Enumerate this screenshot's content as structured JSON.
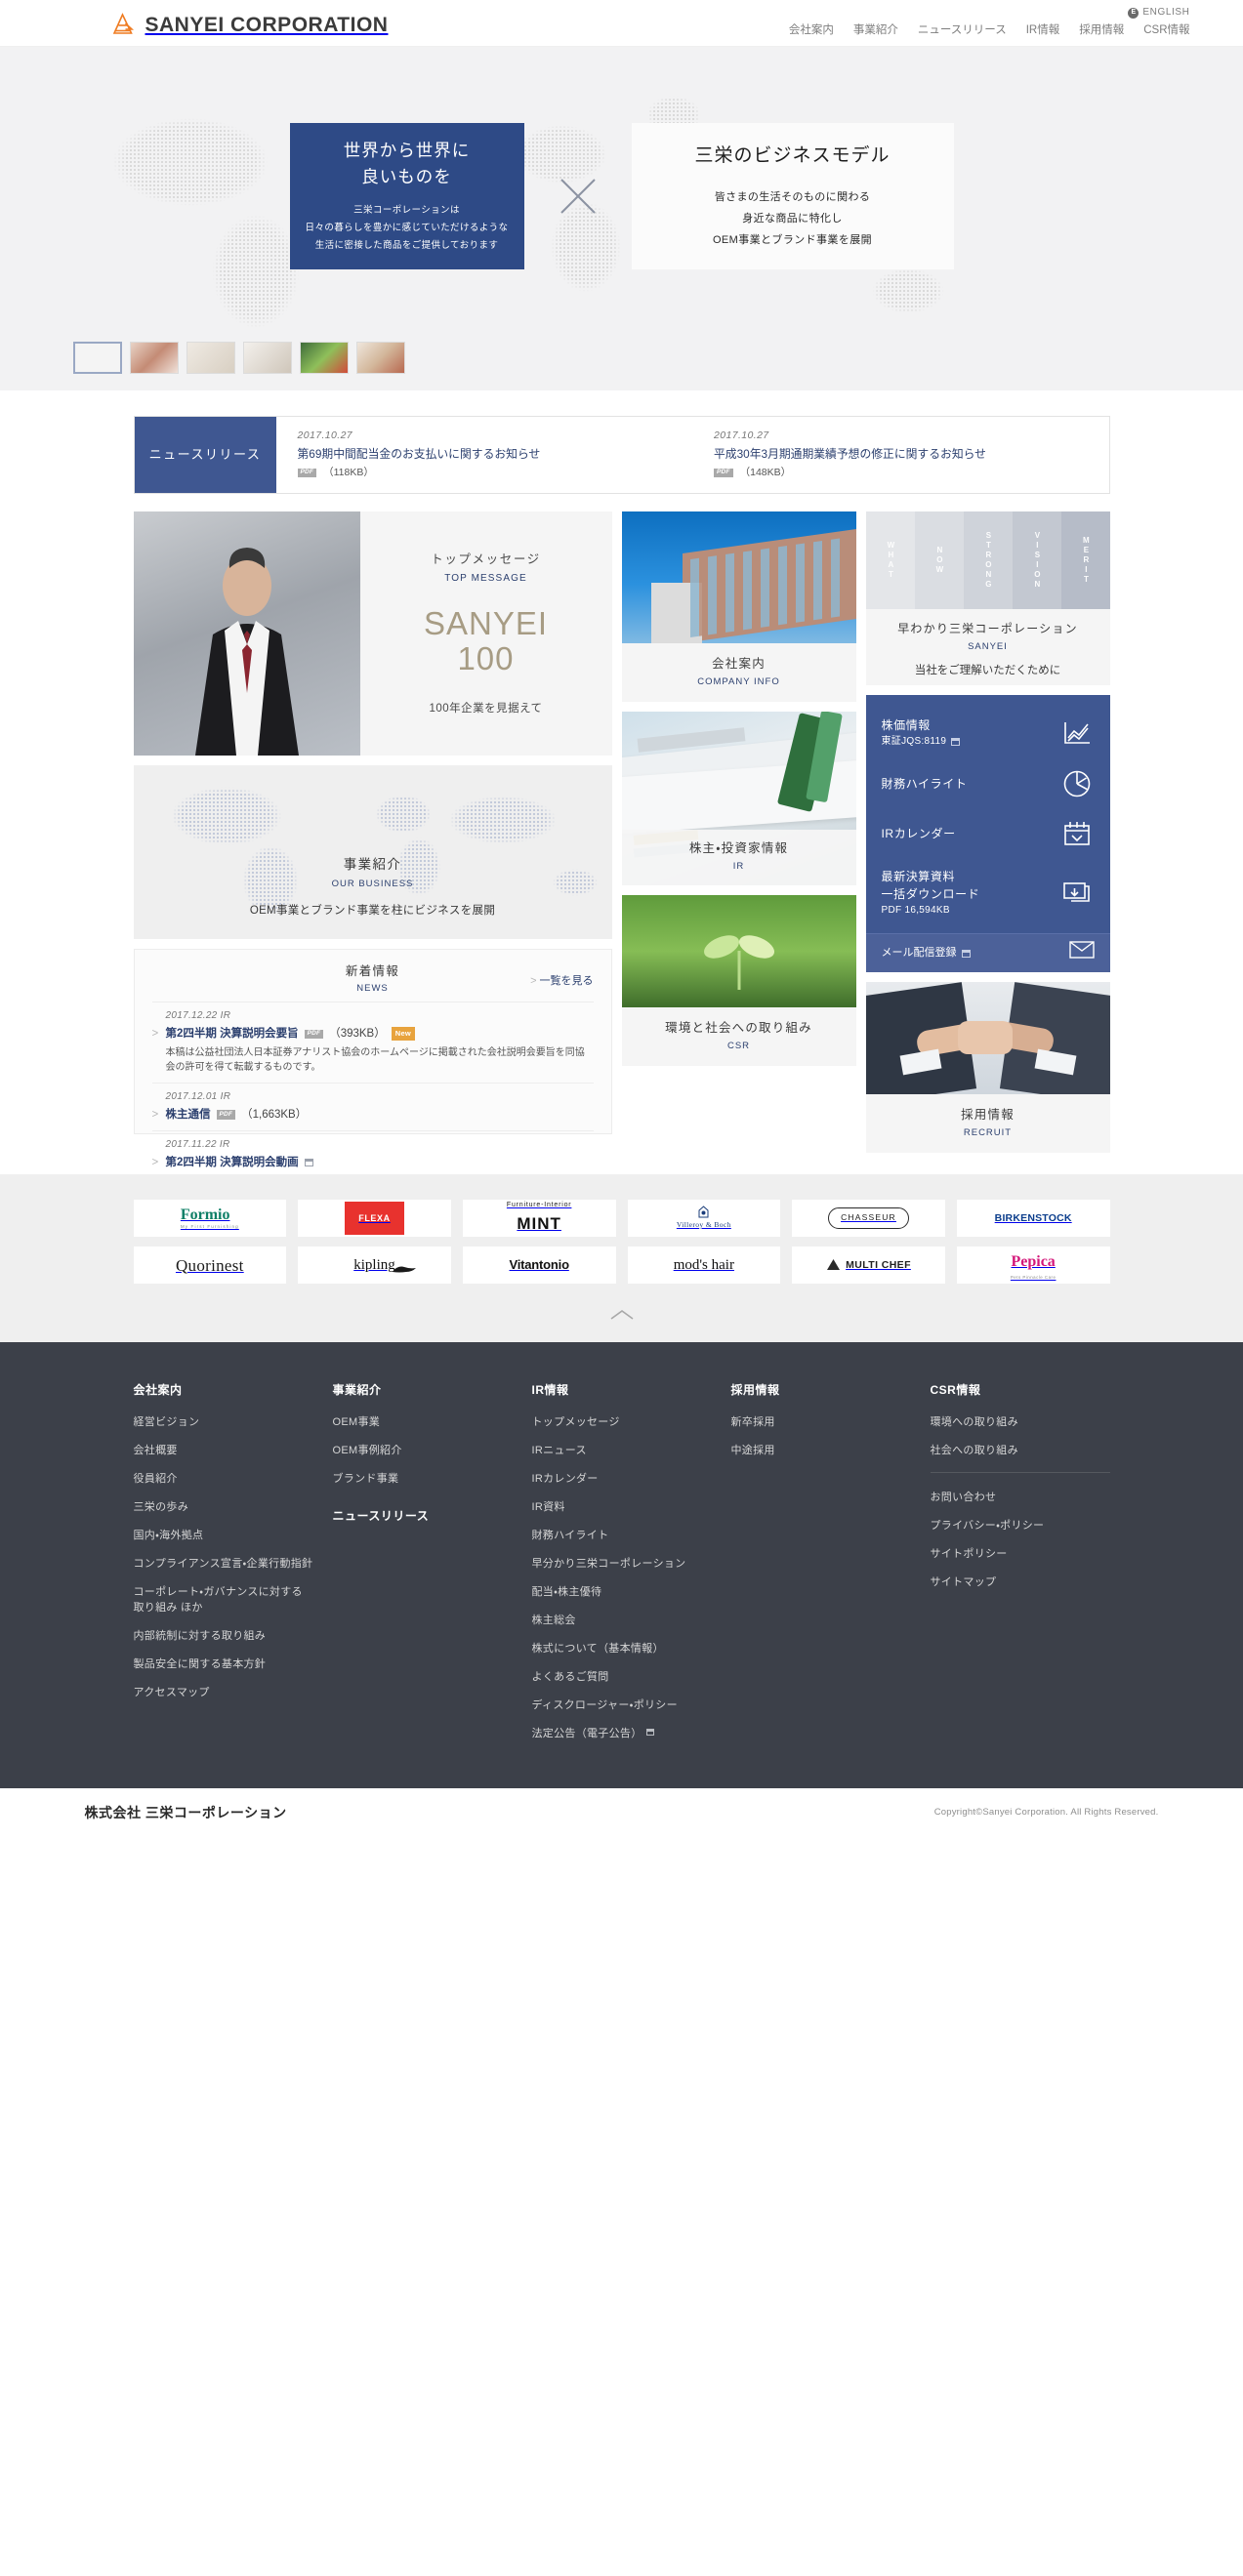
{
  "header": {
    "logo_text": "SANYEI CORPORATION",
    "lang_label": "ENGLISH",
    "lang_icon": "globe-icon",
    "nav": [
      {
        "label": "会社案内"
      },
      {
        "label": "事業紹介"
      },
      {
        "label": "ニュースリリース"
      },
      {
        "label": "IR情報"
      },
      {
        "label": "採用情報"
      },
      {
        "label": "CSR情報"
      }
    ]
  },
  "hero": {
    "left": {
      "heading_line1": "世界から世界に",
      "heading_line2": "良いものを",
      "body_line1": "三栄コーポレーションは",
      "body_line2": "日々の暮らしを豊かに感じていただけるような",
      "body_line3": "生活に密接した商品をご提供しております"
    },
    "divider_icon": "cross-icon",
    "right": {
      "heading": "三栄のビジネスモデル",
      "body_line1": "皆さまの生活そのものに関わる",
      "body_line2": "身近な商品に特化し",
      "body_line3": "OEM事業とブランド事業を展開"
    },
    "thumbnails": [
      {
        "name": "thumb-world-map",
        "selected": true
      },
      {
        "name": "thumb-cosmetics",
        "selected": false
      },
      {
        "name": "thumb-slippers",
        "selected": false
      },
      {
        "name": "thumb-interior",
        "selected": false
      },
      {
        "name": "thumb-toys",
        "selected": false
      },
      {
        "name": "thumb-tableware",
        "selected": false
      }
    ]
  },
  "news_release": {
    "label": "ニュースリリース",
    "items": [
      {
        "date": "2017.10.27",
        "title": "第69期中間配当金のお支払いに関するお知らせ",
        "badge": "PDF",
        "size": "（118KB）"
      },
      {
        "date": "2017.10.27",
        "title": "平成30年3月期通期業績予想の修正に関するお知らせ",
        "badge": "PDF",
        "size": "（148KB）"
      }
    ]
  },
  "cards": {
    "top_message": {
      "jp": "トップメッセージ",
      "en": "TOP MESSAGE",
      "big_line1": "SANYEI",
      "big_line2": "100",
      "sub": "100年企業を見据えて"
    },
    "company_info": {
      "jp": "会社案内",
      "en": "COMPANY INFO"
    },
    "hayawakari": {
      "jp": "早わかり三栄コーポレーション",
      "en": "SANYEI",
      "sub": "当社をご理解いただくために",
      "segments": [
        "WHAT",
        "NOW",
        "STRONG",
        "VISION",
        "MERIT"
      ]
    },
    "business": {
      "jp": "事業紹介",
      "en": "OUR BUSINESS",
      "sub": "OEM事業とブランド事業を柱にビジネスを展開"
    },
    "ir": {
      "jp": "株主・投資家情報",
      "en": "IR"
    },
    "csr": {
      "jp": "環境と社会への取り組み",
      "en": "CSR"
    },
    "recruit": {
      "jp": "採用情報",
      "en": "RECRUIT"
    }
  },
  "ir_panel": {
    "rows": [
      {
        "line1": "株価情報",
        "line2": "東証JQS:8119",
        "icon": "line-chart-icon",
        "external": true
      },
      {
        "line1": "財務ハイライト",
        "line2": "",
        "icon": "pie-chart-icon",
        "external": false
      },
      {
        "line1": "IRカレンダー",
        "line2": "",
        "icon": "calendar-icon",
        "external": false
      },
      {
        "line1": "最新決算資料",
        "line1b": "一括ダウンロード",
        "line2": "PDF 16,594KB",
        "icon": "download-screen-icon",
        "external": false
      }
    ],
    "mail": {
      "label": "メール配信登録",
      "icon": "envelope-icon",
      "external": true
    }
  },
  "news": {
    "heading_jp": "新着情報",
    "heading_en": "NEWS",
    "view_all": "一覧を見る",
    "items": [
      {
        "date": "2017.12.22",
        "category": "IR",
        "title": "第2四半期 決算説明会要旨",
        "badge": "PDF",
        "size": "（393KB）",
        "is_new": true,
        "new_label": "New",
        "desc": "本稿は公益社団法人日本証券アナリスト協会のホームページに掲載された会社説明会要旨を同協会の許可を得て転載するものです。"
      },
      {
        "date": "2017.12.01",
        "category": "IR",
        "title": "株主通信",
        "badge": "PDF",
        "size": "（1,663KB）",
        "is_new": false,
        "desc": ""
      },
      {
        "date": "2017.11.22",
        "category": "IR",
        "title": "第2四半期 決算説明会動画",
        "badge": "",
        "size": "",
        "is_new": false,
        "external": true,
        "desc": ""
      }
    ]
  },
  "brands": [
    {
      "name": "Formio",
      "tagline": "My First Furnishing"
    },
    {
      "name": "FLEXA",
      "tagline": ""
    },
    {
      "name": "MINT",
      "tagline": "Furniture-Interior"
    },
    {
      "name": "Villeroy & Boch",
      "tagline": ""
    },
    {
      "name": "CHASSEUR",
      "tagline": ""
    },
    {
      "name": "BIRKENSTOCK",
      "tagline": ""
    },
    {
      "name": "Quorinest",
      "tagline": ""
    },
    {
      "name": "kipling",
      "tagline": ""
    },
    {
      "name": "Vitantonio",
      "tagline": ""
    },
    {
      "name": "mod's hair",
      "tagline": ""
    },
    {
      "name": "MULTI CHEF",
      "tagline": ""
    },
    {
      "name": "Pepica",
      "tagline": "Pets Pinnacle Care"
    }
  ],
  "pagetop": {
    "label": "^",
    "icon": "chevron-up-icon"
  },
  "footer": {
    "columns": [
      {
        "title": "会社案内",
        "links": [
          {
            "label": "経営ビジョン"
          },
          {
            "label": "会社概要"
          },
          {
            "label": "役員紹介"
          },
          {
            "label": "三栄の歩み"
          },
          {
            "label": "国内・海外拠点"
          },
          {
            "label": "コンプライアンス宣言・企業行動指針"
          },
          {
            "label": "コーポレート・ガバナンスに対する取り組み ほか"
          },
          {
            "label": "内部統制に対する取り組み"
          },
          {
            "label": "製品安全に関する基本方針"
          },
          {
            "label": "アクセスマップ"
          }
        ]
      },
      {
        "title": "事業紹介",
        "links": [
          {
            "label": "OEM事業"
          },
          {
            "label": "OEM事例紹介"
          },
          {
            "label": "ブランド事業"
          }
        ],
        "title2": "ニュースリリース",
        "links2": []
      },
      {
        "title": "IR情報",
        "links": [
          {
            "label": "トップメッセージ"
          },
          {
            "label": "IRニュース"
          },
          {
            "label": "IRカレンダー"
          },
          {
            "label": "IR資料"
          },
          {
            "label": "財務ハイライト"
          },
          {
            "label": "早分かり三栄コーポレーション"
          },
          {
            "label": "配当・株主優待"
          },
          {
            "label": "株主総会"
          },
          {
            "label": "株式について（基本情報）"
          },
          {
            "label": "よくあるご質問"
          },
          {
            "label": "ディスクロージャー・ポリシー"
          },
          {
            "label": "法定公告（電子公告）",
            "external": true
          }
        ]
      },
      {
        "title": "採用情報",
        "links": [
          {
            "label": "新卒採用"
          },
          {
            "label": "中途採用"
          }
        ]
      },
      {
        "title": "CSR情報",
        "links": [
          {
            "label": "環境への取り組み"
          },
          {
            "label": "社会への取り組み"
          }
        ],
        "separator": true,
        "links2": [
          {
            "label": "お問い合わせ"
          },
          {
            "label": "プライバシー・ポリシー"
          },
          {
            "label": "サイトポリシー"
          },
          {
            "label": "サイトマップ"
          }
        ]
      }
    ],
    "company_name": "株式会社 三栄コーポレーション",
    "copyright": "Copyright©Sanyei Corporation. All Rights Reserved."
  },
  "colors": {
    "brand_blue": "#3f5791",
    "hero_blue": "#2e4a86",
    "logo_orange": "#ef7c22",
    "footer_bg": "#3c4049",
    "gold": "#a79c84",
    "new_badge": "#e8a33d"
  }
}
